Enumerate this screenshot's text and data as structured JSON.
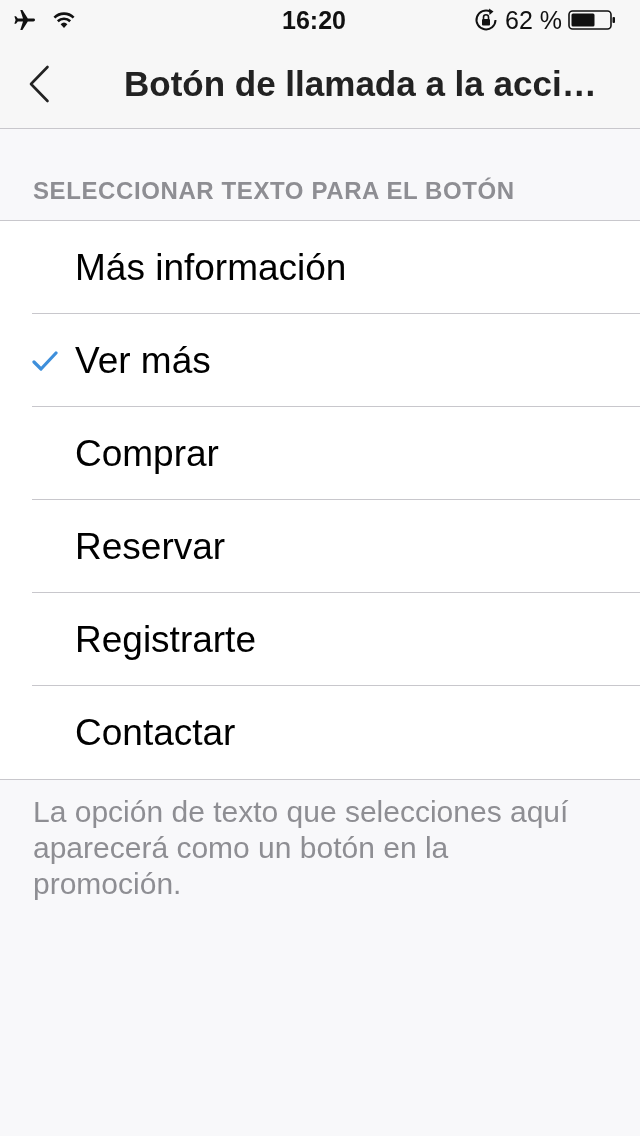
{
  "status_bar": {
    "time": "16:20",
    "battery_percent": "62 %"
  },
  "nav_bar": {
    "title": "Botón de llamada a la acci…"
  },
  "section": {
    "header": "SELECCIONAR TEXTO PARA EL BOTÓN",
    "options": [
      {
        "label": "Más información",
        "selected": false
      },
      {
        "label": "Ver más",
        "selected": true
      },
      {
        "label": "Comprar",
        "selected": false
      },
      {
        "label": "Reservar",
        "selected": false
      },
      {
        "label": "Registrarte",
        "selected": false
      },
      {
        "label": "Contactar",
        "selected": false
      }
    ],
    "footer": "La opción de texto que selecciones aquí aparecerá como un botón en la promoción."
  }
}
